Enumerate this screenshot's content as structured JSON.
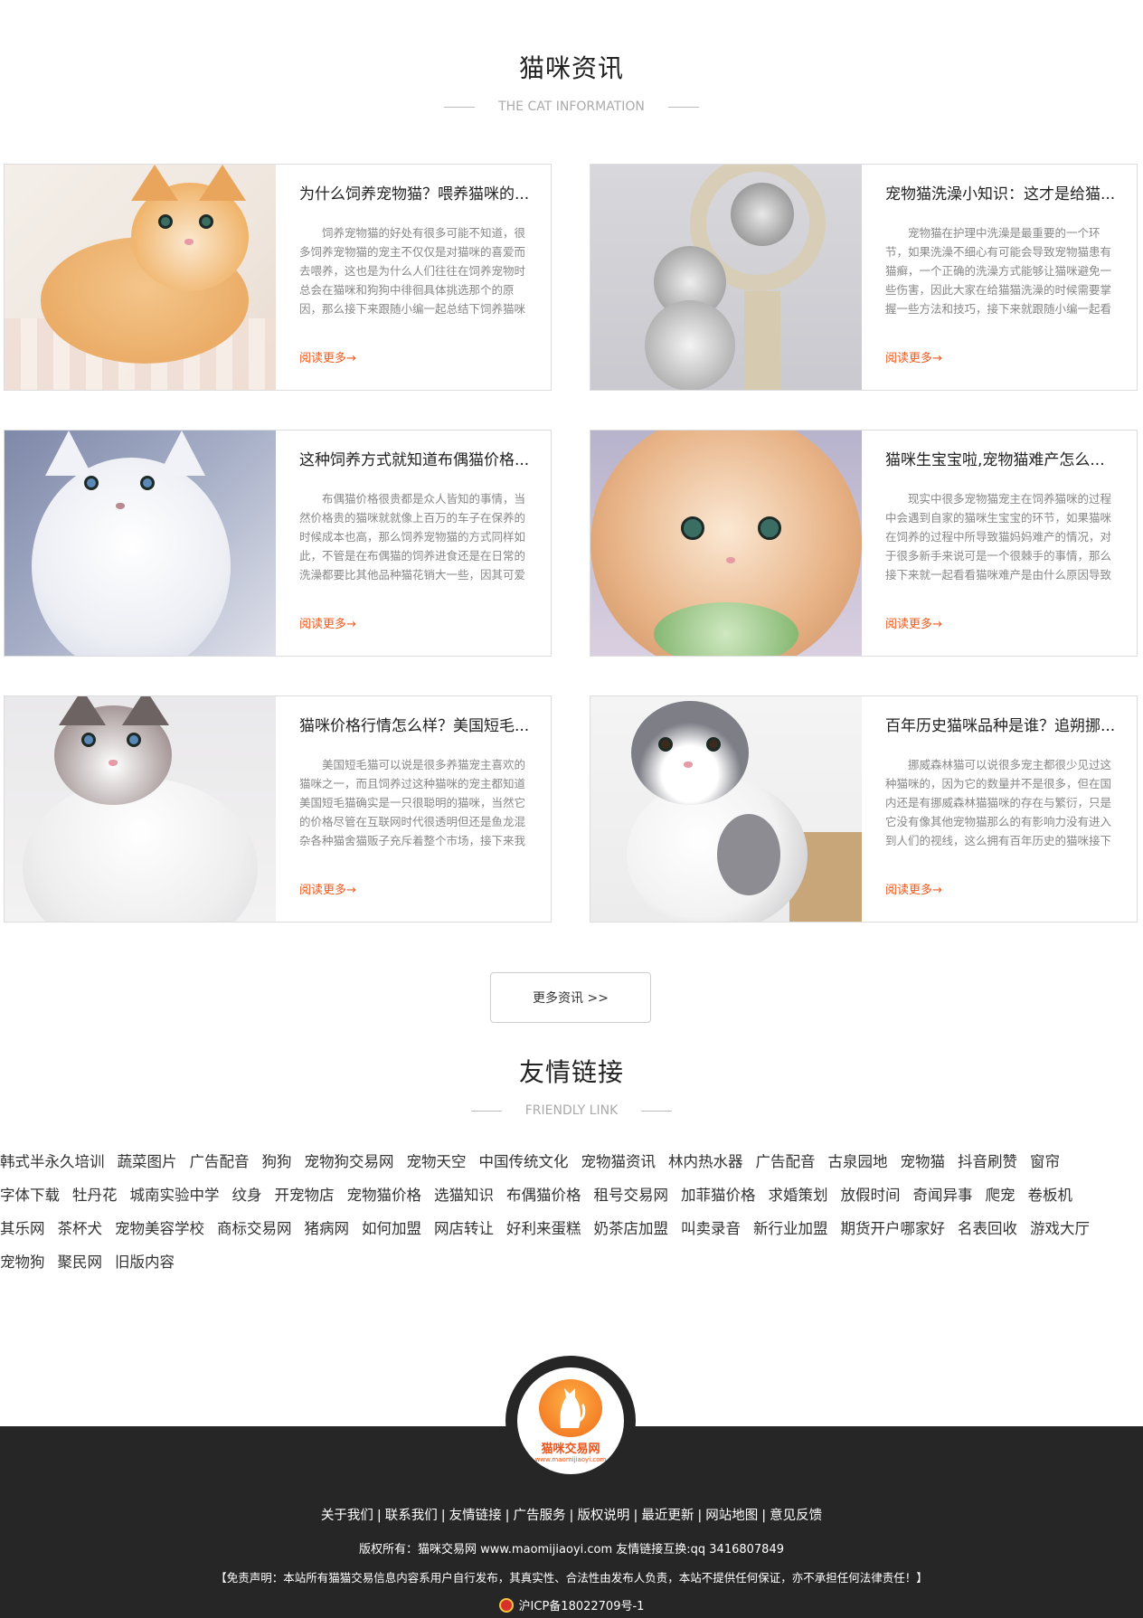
{
  "news_section": {
    "title": "猫咪资讯",
    "subtitle": "THE CAT INFORMATION",
    "read_more": "阅读更多→",
    "articles": [
      {
        "title": "为什么饲养宠物猫？喂养猫咪的...",
        "excerpt": "饲养宠物猫的好处有很多可能不知道，很多饲养宠物猫的宠主不仅仅是对猫咪的喜爱而去喂养，这也是为什么人们往往在饲养宠物时总会在猫咪和狗狗中徘徊具体挑选那个的原因，那么接下来跟随小编一起总结下饲养猫咪"
      },
      {
        "title": "宠物猫洗澡小知识：这才是给猫...",
        "excerpt": "宠物猫在护理中洗澡是最重要的一个环节，如果洗澡不细心有可能会导致宠物猫患有猫癣，一个正确的洗澡方式能够让猫咪避免一些伤害，因此大家在给猫猫洗澡的时候需要掌握一些方法和技巧，接下来就跟随小编一起看"
      },
      {
        "title": "这种饲养方式就知道布偶猫价格...",
        "excerpt": "布偶猫价格很贵都是众人皆知的事情，当然价格贵的猫咪就就像上百万的车子在保养的时候成本也高，那么饲养宠物猫的方式同样如此，不管是在布偶猫的饲养进食还是在日常的洗澡都要比其他品种猫花销大一些，因其可爱"
      },
      {
        "title": "猫咪生宝宝啦,宠物猫难产怎么...",
        "excerpt": "现实中很多宠物猫宠主在饲养猫咪的过程中会遇到自家的猫咪生宝宝的环节，如果猫咪在饲养的过程中所导致猫妈妈难产的情况，对于很多新手来说可是一个很棘手的事情，那么接下来就一起看看猫咪难产是由什么原因导致"
      },
      {
        "title": "猫咪价格行情怎么样？美国短毛...",
        "excerpt": "美国短毛猫可以说是很多养猫宠主喜欢的猫咪之一，而且饲养过这种猫咪的宠主都知道美国短毛猫确实是一只很聪明的猫咪，当然它的价格尽管在互联网时代很透明但还是鱼龙混杂各种猫舍猫贩子充斥着整个市场，接下来我"
      },
      {
        "title": "百年历史猫咪品种是谁？追朔挪...",
        "excerpt": "挪威森林猫可以说很多宠主都很少见过这种猫咪的，因为它的数量并不是很多，但在国内还是有挪威森林猫猫咪的存在与繁衍，只是它没有像其他宠物猫那么的有影响力没有进入到人们的视线，这么拥有百年历史的猫咪接下来"
      }
    ],
    "more_button": "更多资讯 >>"
  },
  "links_section": {
    "title": "友情链接",
    "subtitle": "FRIENDLY LINK",
    "rows": [
      [
        "韩式半永久培训",
        "蔬菜图片",
        "广告配音",
        "狗狗",
        "宠物狗交易网",
        "宠物天空",
        "中国传统文化",
        "宠物猫资讯",
        "林内热水器",
        "广告配音",
        "古泉园地",
        "宠物猫",
        "抖音刷赞",
        "窗帘"
      ],
      [
        "字体下载",
        "牡丹花",
        "城南实验中学",
        "纹身",
        "开宠物店",
        "宠物猫价格",
        "选猫知识",
        "布偶猫价格",
        "租号交易网",
        "加菲猫价格",
        "求婚策划",
        "放假时间",
        "奇闻异事",
        "爬宠",
        "卷板机"
      ],
      [
        "其乐网",
        "茶杯犬",
        "宠物美容学校",
        "商标交易网",
        "猪病网",
        "如何加盟",
        "网店转让",
        "好利来蛋糕",
        "奶茶店加盟",
        "叫卖录音",
        "新行业加盟",
        "期货开户哪家好",
        "名表回收",
        "游戏大厅"
      ],
      [
        "宠物狗",
        "聚民网",
        "旧版内容"
      ]
    ]
  },
  "footer": {
    "logo_name": "猫咪交易网",
    "logo_url": "www.maomijiaoyi.com",
    "nav": [
      "关于我们",
      "联系我们",
      "友情链接",
      "广告服务",
      "版权说明",
      "最近更新",
      "网站地图",
      "意见反馈"
    ],
    "nav_separator": "|",
    "copyright": "版权所有：猫咪交易网 www.maomijiaoyi.com 友情链接互换:qq 3416807849",
    "disclaimer": "【免责声明：本站所有猫猫交易信息内容系用户自行发布，其真实性、合法性由发布人负责，本站不提供任何保证，亦不承担任何法律责任！】",
    "icp": "沪ICP备18022709号-1"
  }
}
